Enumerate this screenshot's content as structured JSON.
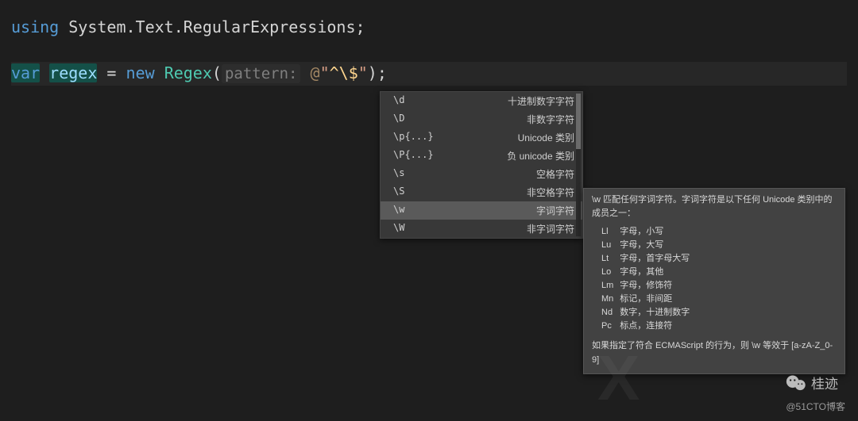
{
  "code": {
    "kw_using": "using",
    "ns": " System.Text.RegularExpressions",
    "semi": ";",
    "kw_var": "var",
    "varname": "regex",
    "eq": " = ",
    "kw_new": "new",
    "type": "Regex",
    "paren_open": "(",
    "param_label": "pattern:",
    "at": "@",
    "quote": "\"",
    "str_caret": "^",
    "str_esc": "\\$",
    "paren_close": ")",
    "semi2": ";"
  },
  "popup1": {
    "items": [
      {
        "k": "\\d",
        "d": "十进制数字字符"
      },
      {
        "k": "\\D",
        "d": "非数字字符"
      },
      {
        "k": "\\p{...}",
        "d": "Unicode 类别"
      },
      {
        "k": "\\P{...}",
        "d": "负 unicode 类别"
      },
      {
        "k": "\\s",
        "d": "空格字符"
      },
      {
        "k": "\\S",
        "d": "非空格字符"
      },
      {
        "k": "\\w",
        "d": "字词字符"
      },
      {
        "k": "\\W",
        "d": "非字词字符"
      }
    ],
    "selected": 6
  },
  "popup2": {
    "head": "\\w 匹配任何字词字符。字词字符是以下任何 Unicode 类别中的成员之一：",
    "rows": [
      {
        "c": "Ll",
        "d": "字母，小写"
      },
      {
        "c": "Lu",
        "d": "字母，大写"
      },
      {
        "c": "Lt",
        "d": "字母，首字母大写"
      },
      {
        "c": "Lo",
        "d": "字母，其他"
      },
      {
        "c": "Lm",
        "d": "字母，修饰符"
      },
      {
        "c": "Mn",
        "d": "标记，非间距"
      },
      {
        "c": "Nd",
        "d": "数字，十进制数字"
      },
      {
        "c": "Pc",
        "d": "标点，连接符"
      }
    ],
    "foot": "如果指定了符合 ECMAScript 的行为，则 \\w 等效于 [a-zA-Z_0-9]"
  },
  "watermark": "桂迹",
  "attr": "@51CTO博客"
}
